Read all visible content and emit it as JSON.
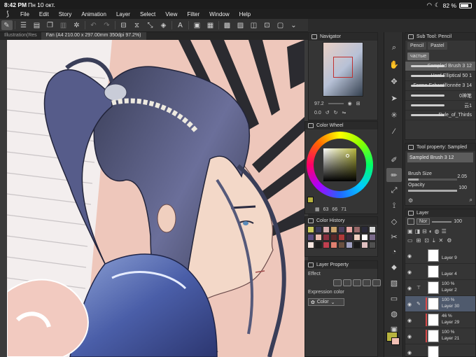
{
  "status": {
    "time": "8:42 PM",
    "date": "Пн 10 окт.",
    "battery": "82 %",
    "battery_level": 0.82
  },
  "menu": [
    "File",
    "Edit",
    "Story",
    "Animation",
    "Layer",
    "Select",
    "View",
    "Filter",
    "Window",
    "Help"
  ],
  "tabs": [
    "Illustration(Res",
    "Fan (A4 210.00 x 297.00mm 350dpi 97.2%)"
  ],
  "navigator": {
    "title": "Navigator",
    "zoom": "97.2",
    "rotation": "0.0"
  },
  "color_wheel": {
    "title": "Color Wheel",
    "values": [
      "63",
      "66",
      "71"
    ],
    "main_color": "#b7b33e",
    "sub_color": "#f2c0b5"
  },
  "color_history": {
    "title": "Color History",
    "swatches": [
      "#c9c85a",
      "#3a3a5a",
      "#d6b0b0",
      "#caa46c",
      "#4a3f5e",
      "#e8a6a2",
      "#9a6a6a",
      "#2a2a3a",
      "#d9d9d9",
      "#5a4c80",
      "#e9b9ad",
      "#8a3040",
      "#5a2a2a",
      "#b03a3a",
      "#3a2a3a",
      "#f0d0c0",
      "#ffffff",
      "#7a6a8a",
      "#f6e6e0",
      "#202020",
      "#c04050",
      "#e08070",
      "#6a5040",
      "#a0a0c0",
      "#1a1a1a",
      "#e0c0c0",
      "#505050"
    ]
  },
  "layer_property": {
    "title": "Layer Property",
    "effect_label": "Effect",
    "expression_label": "Expression color",
    "expression_value": "Color"
  },
  "subtool": {
    "title": "Sub Tool: Pencil",
    "tabs": [
      "Pencil",
      "Pastel",
      "частые"
    ],
    "brushes": [
      "Sampled Brush 3 12",
      "Hard Elliptical 50 1",
      "Forme Echantillonnée 3 14",
      "0神笔",
      "云1",
      "Rule_of_Thirds"
    ]
  },
  "tool_property": {
    "title": "Tool property: Sampled",
    "brush_name": "Sampled Brush 3 12",
    "brush_size_label": "Brush Size",
    "brush_size": "2.05",
    "brush_size_level": 0.22,
    "opacity_label": "Opacity",
    "opacity": "100",
    "opacity_level": 1.0
  },
  "layer_panel": {
    "title": "Layer",
    "blend_mode": "Nor",
    "opacity": "100",
    "layers": [
      {
        "pct": "",
        "name": "Layer 9",
        "color": ""
      },
      {
        "pct": "",
        "name": "Layer 4",
        "color": ""
      },
      {
        "pct": "100 %",
        "name": "Layer 2",
        "color": ""
      },
      {
        "pct": "100 %",
        "name": "Layer 30",
        "color": "#d94a4a"
      },
      {
        "pct": "46 %",
        "name": "Layer 29",
        "color": "#d94a4a"
      },
      {
        "pct": "100 %",
        "name": "Layer 21",
        "color": "#d94a4a"
      },
      {
        "pct": "",
        "name": "",
        "color": ""
      }
    ]
  }
}
